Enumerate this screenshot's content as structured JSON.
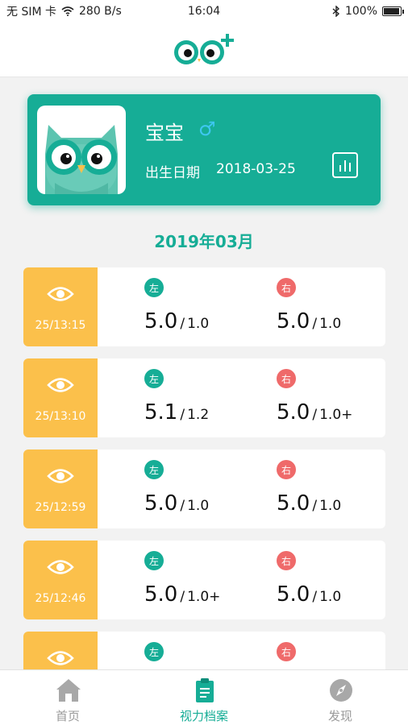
{
  "status_bar": {
    "carrier": "无 SIM 卡",
    "network_speed": "280 B/s",
    "time": "16:04",
    "battery": "100%",
    "battery_level": 1.0
  },
  "profile": {
    "name": "宝宝",
    "gender_symbol": "♂",
    "birth_label": "出生日期",
    "birth_date": "2018-03-25"
  },
  "month_title": "2019年03月",
  "labels": {
    "left_eye": "左",
    "right_eye": "右"
  },
  "records": [
    {
      "time": "25/13:15",
      "left_main": "5.0",
      "left_sub": "1.0",
      "right_main": "5.0",
      "right_sub": "1.0"
    },
    {
      "time": "25/13:10",
      "left_main": "5.1",
      "left_sub": "1.2",
      "right_main": "5.0",
      "right_sub": "1.0+"
    },
    {
      "time": "25/12:59",
      "left_main": "5.0",
      "left_sub": "1.0",
      "right_main": "5.0",
      "right_sub": "1.0"
    },
    {
      "time": "25/12:46",
      "left_main": "5.0",
      "left_sub": "1.0+",
      "right_main": "5.0",
      "right_sub": "1.0"
    },
    {
      "time": "",
      "left_main": "",
      "left_sub": "",
      "right_main": "",
      "right_sub": ""
    }
  ],
  "tabs": [
    {
      "label": "首页",
      "icon": "home-icon",
      "active": false
    },
    {
      "label": "视力档案",
      "icon": "clipboard-icon",
      "active": true
    },
    {
      "label": "发现",
      "icon": "compass-icon",
      "active": false
    }
  ],
  "colors": {
    "brand": "#16ad96",
    "record_accent": "#fbc04b",
    "right_eye": "#ef6a6a",
    "gender": "#3ec7f0"
  }
}
